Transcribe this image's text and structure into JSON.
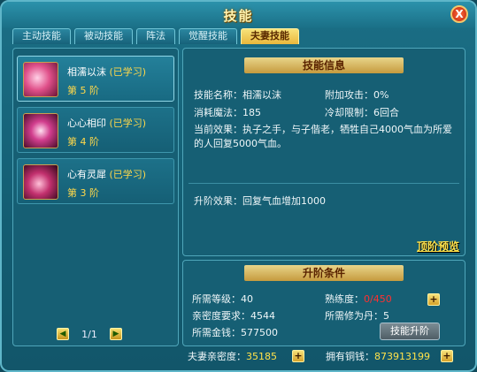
{
  "window": {
    "title": "技能",
    "close_label": "X"
  },
  "tabs": [
    "主动技能",
    "被动技能",
    "阵法",
    "觉醒技能",
    "夫妻技能"
  ],
  "active_tab": 4,
  "skills": [
    {
      "name": "相濡以沫",
      "status": "(已学习)",
      "level": "第 5 阶",
      "icon": "hearts-embrace-icon",
      "color": "#e0508a"
    },
    {
      "name": "心心相印",
      "status": "(已学习)",
      "level": "第 4 阶",
      "icon": "heart-seal-icon",
      "color": "#d23e8e"
    },
    {
      "name": "心有灵犀",
      "status": "(已学习)",
      "level": "第 3 阶",
      "icon": "heart-swirl-icon",
      "color": "#c2306e"
    }
  ],
  "pager": {
    "text": "1/1",
    "prev": "◀",
    "next": "▶"
  },
  "info": {
    "header": "技能信息",
    "name_label": "技能名称：相濡以沫",
    "attack_label": "附加攻击：0%",
    "mana_label": "消耗魔法：185",
    "cooldown_label": "冷却限制：6回合",
    "effect_label": "当前效果：执子之手，与子偕老，牺牲自己4000气血为所爱的人回复5000气血。",
    "upgrade_effect": "升阶效果：回复气血增加1000",
    "top_link": "顶阶预览"
  },
  "conditions": {
    "header": "升阶条件",
    "level_req": "所需等级：40",
    "proficiency_label": "熟练度：",
    "proficiency_value": "0/450",
    "intimacy_req": "亲密度要求：4544",
    "pill_req": "所需修为丹：5",
    "money_req": "所需金钱：577500",
    "upgrade_button": "技能升阶"
  },
  "bottom": {
    "intimacy_label": "夫妻亲密度：",
    "intimacy_value": "35185",
    "coins_label": "拥有铜钱：",
    "coins_value": "873913199"
  }
}
